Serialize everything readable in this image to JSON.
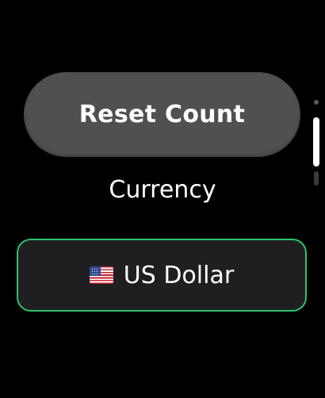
{
  "reset_button": {
    "label": "Reset Count"
  },
  "currency_section": {
    "title": "Currency",
    "selected": {
      "flag_icon": "us-flag-icon",
      "label": "US Dollar"
    }
  },
  "scroll_indicator": {
    "position": 0.2
  },
  "colors": {
    "background": "#000000",
    "button_fill": "#505050",
    "picker_fill": "#1f1f21",
    "selection_accent": "#2dc46c",
    "text": "#ffffff"
  }
}
